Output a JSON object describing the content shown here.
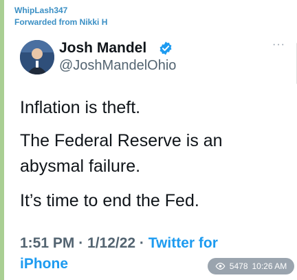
{
  "forward": {
    "sender": "WhipLash347",
    "forwarded_from": "Forwarded from Nikki H"
  },
  "tweet": {
    "author_name": "Josh Mandel",
    "handle": "@JoshMandelOhio",
    "verified_icon": "verified-badge-icon",
    "more_icon": "more-options-icon",
    "more_label": "···",
    "lines": [
      "Inflation is theft.",
      "The Federal Reserve is an",
      "abysmal failure.",
      "It’s time to end the Fed."
    ],
    "timestamp": "1:51 PM · 1/12/22 · ",
    "source_part1": "Twitter for",
    "source_part2": "iPhone"
  },
  "message_meta": {
    "views": "5478",
    "time": "10:26 AM"
  },
  "colors": {
    "link": "#3a8fc4",
    "twitter_blue": "#1d9bf0",
    "verified": "#1d9bf0",
    "badge_bg": "#9aa4ae"
  }
}
